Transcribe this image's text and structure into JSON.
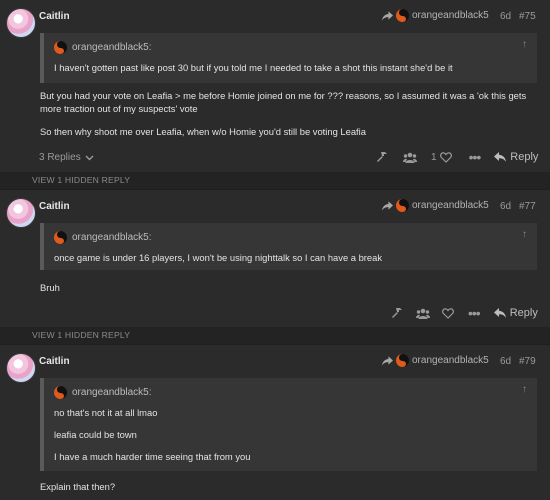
{
  "posts": [
    {
      "username": "Caitlin",
      "reply_to": "orangeandblack5",
      "time": "6d",
      "number": "#75",
      "quote": {
        "author": "orangeandblack5:",
        "lines": [
          "I haven't gotten past like post 30 but if you told me I needed to take a shot this instant she'd be it"
        ]
      },
      "body": [
        "But you had your vote on Leafia > me before Homie joined on me for ??? reasons, so I assumed it was a 'ok this gets more traction out of my suspects' vote",
        "So then why shoot me over Leafia, when w/o Homie you'd still be voting Leafia"
      ],
      "replies_label": "3 Replies",
      "like_count": "1",
      "reply_label": "Reply"
    },
    {
      "username": "Caitlin",
      "reply_to": "orangeandblack5",
      "time": "6d",
      "number": "#77",
      "quote": {
        "author": "orangeandblack5:",
        "lines": [
          "once game is under 16 players, I won't be using nighttalk so I can have a break"
        ]
      },
      "body": [
        "Bruh"
      ],
      "reply_label": "Reply"
    },
    {
      "username": "Caitlin",
      "reply_to": "orangeandblack5",
      "time": "6d",
      "number": "#79",
      "quote": {
        "author": "orangeandblack5:",
        "lines": [
          "no that's not it at all lmao",
          "leafia could be town",
          "I have a much harder time seeing that from you"
        ]
      },
      "body": [
        "Explain that then?"
      ]
    }
  ],
  "hidden_replies": [
    "VIEW 1 HIDDEN REPLY",
    "VIEW 1 HIDDEN REPLY"
  ],
  "icons": [
    "reply-arrow-icon",
    "yinyang-avatar-icon",
    "up-arrow-icon",
    "hammer-icon",
    "users-icon",
    "heart-icon",
    "more-icon",
    "reply-icon",
    "chevron-down-icon"
  ],
  "colors": {
    "background": "#2b2b2b",
    "quote_bg": "#363636",
    "accent_orange": "#e05a1c"
  }
}
